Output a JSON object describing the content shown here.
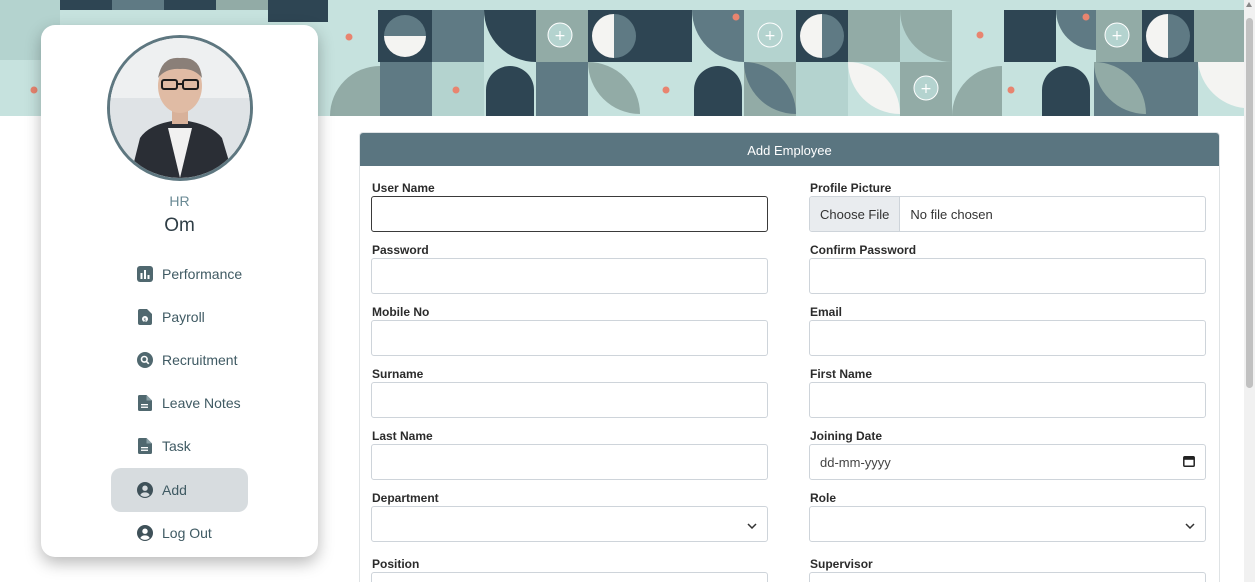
{
  "profile": {
    "role": "HR",
    "name": "Om"
  },
  "nav": [
    {
      "label": "Performance",
      "icon": "bar-chart-icon"
    },
    {
      "label": "Payroll",
      "icon": "payroll-file-icon"
    },
    {
      "label": "Recruitment",
      "icon": "search-icon"
    },
    {
      "label": "Leave Notes",
      "icon": "document-icon"
    },
    {
      "label": "Task",
      "icon": "document-icon"
    },
    {
      "label": "Add",
      "icon": "user-circle-icon",
      "active": true
    },
    {
      "label": "Log Out",
      "icon": "user-circle-icon"
    }
  ],
  "form": {
    "title": "Add Employee",
    "fields": {
      "user_name": {
        "label": "User Name",
        "value": ""
      },
      "profile_picture": {
        "label": "Profile Picture",
        "button": "Choose File",
        "status": "No file chosen"
      },
      "password": {
        "label": "Password",
        "value": ""
      },
      "confirm_password": {
        "label": "Confirm Password",
        "value": ""
      },
      "mobile_no": {
        "label": "Mobile No",
        "value": ""
      },
      "email": {
        "label": "Email",
        "value": ""
      },
      "surname": {
        "label": "Surname",
        "value": ""
      },
      "first_name": {
        "label": "First Name",
        "value": ""
      },
      "last_name": {
        "label": "Last Name",
        "value": ""
      },
      "joining_date": {
        "label": "Joining Date",
        "placeholder": "dd-mm-yyyy"
      },
      "department": {
        "label": "Department",
        "value": ""
      },
      "role": {
        "label": "Role",
        "value": ""
      },
      "position": {
        "label": "Position"
      },
      "supervisor": {
        "label": "Supervisor"
      }
    }
  },
  "colors": {
    "header": "#5a7580",
    "dark_navy": "#2e4553",
    "slate": "#5f7a84",
    "mint": "#c6e2de",
    "sage": "#92aba6",
    "accent_coral": "#e8846f"
  }
}
